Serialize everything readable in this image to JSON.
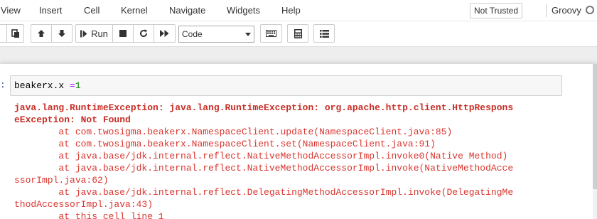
{
  "menubar": {
    "items": [
      "View",
      "Insert",
      "Cell",
      "Kernel",
      "Navigate",
      "Widgets",
      "Help"
    ],
    "trust_status": "Not Trusted",
    "kernel_name": "Groovy"
  },
  "toolbar": {
    "run_label": "Run",
    "cell_type": "Code",
    "icons": [
      "cut-icon",
      "paste-icon",
      "move-up-icon",
      "move-down-icon",
      "run-icon",
      "stop-icon",
      "restart-icon",
      "fast-forward-icon",
      "keyboard-icon",
      "calculator-icon",
      "list-icon"
    ]
  },
  "cell": {
    "prompt": ":",
    "code_name": "beakerx.x ",
    "code_op": "=",
    "code_num": "1",
    "output": {
      "error_line1": "java.lang.RuntimeException: java.lang.RuntimeException: org.apache.http.client.HttpRespons",
      "error_line2": "eException: Not Found",
      "trace": [
        "        at com.twosigma.beakerx.NamespaceClient.update(NamespaceClient.java:85)",
        "        at com.twosigma.beakerx.NamespaceClient.set(NamespaceClient.java:91)",
        "        at java.base/jdk.internal.reflect.NativeMethodAccessorImpl.invoke0(Native Method)",
        "        at java.base/jdk.internal.reflect.NativeMethodAccessorImpl.invoke(NativeMethodAcce",
        "ssorImpl.java:62)",
        "        at java.base/jdk.internal.reflect.DelegatingMethodAccessorImpl.invoke(DelegatingMe",
        "thodAccessorImpl.java:43)",
        "        at this cell line 1"
      ]
    }
  }
}
